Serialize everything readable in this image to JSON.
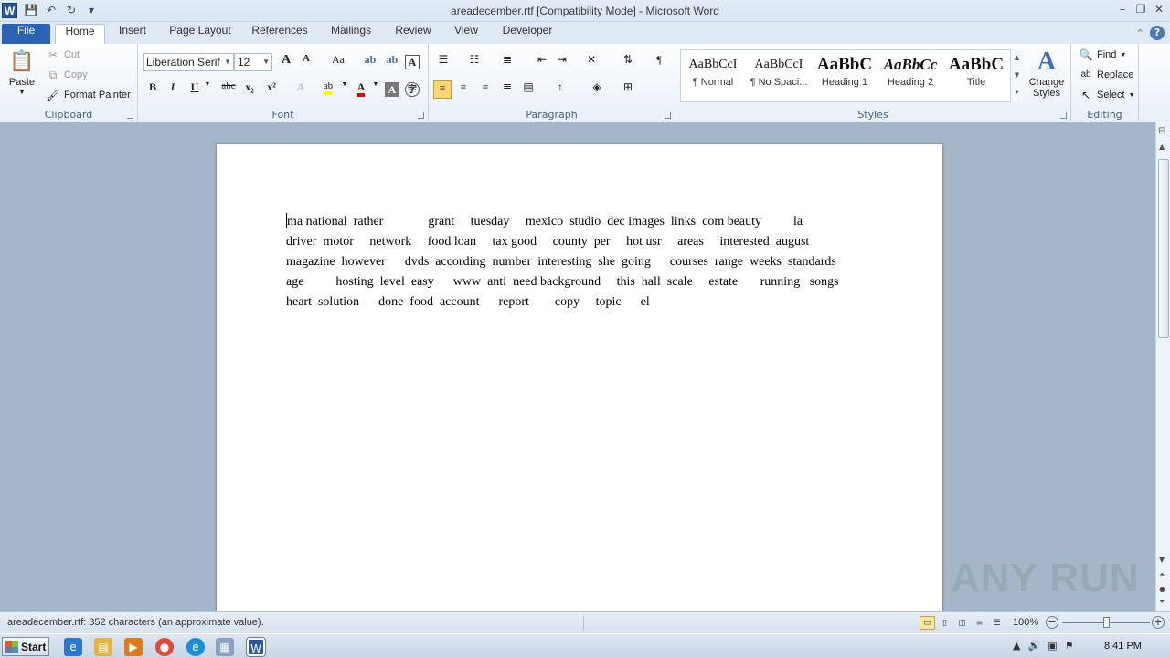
{
  "titlebar": {
    "title": "areadecember.rtf [Compatibility Mode] - Microsoft Word",
    "app_icon_letter": "W"
  },
  "tabs": [
    {
      "label": "File"
    },
    {
      "label": "Home"
    },
    {
      "label": "Insert"
    },
    {
      "label": "Page Layout"
    },
    {
      "label": "References"
    },
    {
      "label": "Mailings"
    },
    {
      "label": "Review"
    },
    {
      "label": "View"
    },
    {
      "label": "Developer"
    }
  ],
  "clipboard": {
    "paste": "Paste",
    "cut": "Cut",
    "copy": "Copy",
    "format_painter": "Format Painter",
    "label": "Clipboard"
  },
  "font": {
    "family": "Liberation Serif",
    "size": "12",
    "label": "Font",
    "bold": "B",
    "italic": "I",
    "underline": "U",
    "strike": "abc",
    "sub": "x₂",
    "sup": "x²",
    "grow": "A",
    "shrink": "A",
    "case": "Aa"
  },
  "paragraph": {
    "label": "Paragraph"
  },
  "styles": {
    "label": "Styles",
    "items": [
      {
        "preview": "AaBbCcI",
        "name": "¶ Normal"
      },
      {
        "preview": "AaBbCcI",
        "name": "¶ No Spaci..."
      },
      {
        "preview": "AaBbC",
        "name": "Heading 1"
      },
      {
        "preview": "AaBbCc",
        "name": "Heading 2"
      },
      {
        "preview": "AaBbC",
        "name": "Title"
      }
    ],
    "change_styles_1": "Change",
    "change_styles_2": "Styles"
  },
  "editing": {
    "find": "Find",
    "replace": "Replace",
    "select": "Select",
    "label": "Editing"
  },
  "document": {
    "lines": [
      "ma national  rather              grant     tuesday     mexico  studio  dec images  links  com beauty          la",
      "driver  motor     network     food loan     tax good     county  per     hot usr     areas     interested  august",
      "magazine  however      dvds  according  number  interesting  she  going      courses  range  weeks  standards",
      "age          hosting  level  easy      www  anti  need background     this  hall  scale     estate       running   songs",
      "heart  solution      done  food  account      report        copy     topic      el"
    ]
  },
  "status": {
    "text": "areadecember.rtf: 352 characters (an approximate value).",
    "zoom": "100%"
  },
  "taskbar": {
    "start": "Start",
    "clock": "8:41 PM"
  },
  "watermark": "ANY RUN"
}
